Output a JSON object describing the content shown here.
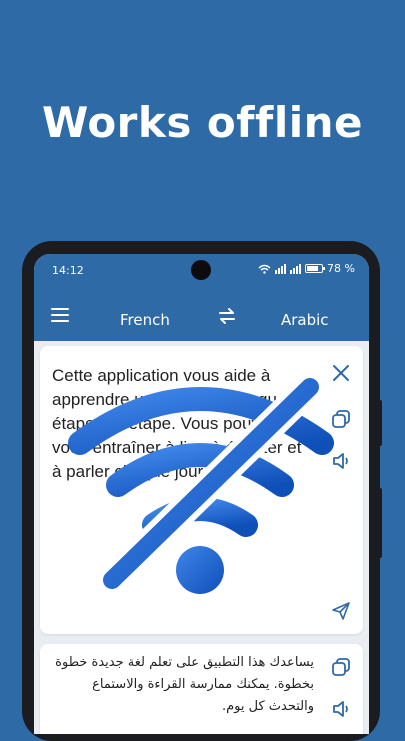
{
  "headline": "Works offline",
  "status": {
    "time": "14:12",
    "battery": "78 %",
    "battery_level": 0.78
  },
  "toolbar": {
    "source_language": "French",
    "target_language": "Arabic"
  },
  "source_card": {
    "text": "Cette application vous aide à apprendre une nouvelle langue étape par étape. Vous pouvez vous entraîner à lire, à écouter et à parler chaque jour."
  },
  "target_card": {
    "text": "يساعدك هذا التطبيق على تعلم لغة جديدة خطوة بخطوة. يمكنك ممارسة القراءة والاستماع والتحدث كل يوم."
  },
  "icons": {
    "menu": "menu-icon",
    "swap": "swap-arrows-icon",
    "close": "close-icon",
    "copy": "copy-icon",
    "speaker": "speaker-icon",
    "send": "send-icon",
    "offline": "wifi-off-icon"
  },
  "colors": {
    "brand": "#2e6aa6",
    "wifi_blue": "#1a5fd0",
    "card": "#ffffff"
  }
}
